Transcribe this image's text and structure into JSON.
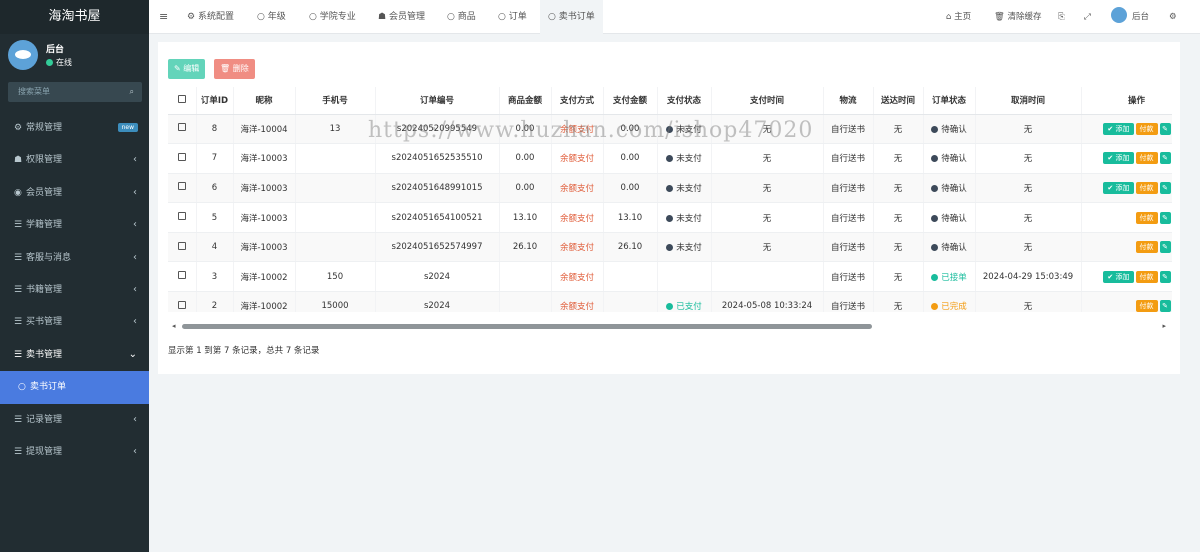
{
  "brand": "海淘书屋",
  "user": {
    "name": "后台",
    "status": "在线"
  },
  "search": {
    "placeholder": "搜索菜单"
  },
  "sidebar": {
    "items": [
      {
        "label": "常规管理",
        "badge": "new"
      },
      {
        "label": "权限管理"
      },
      {
        "label": "会员管理"
      },
      {
        "label": "学籍管理"
      },
      {
        "label": "客服与消息"
      },
      {
        "label": "书籍管理"
      },
      {
        "label": "买书管理"
      },
      {
        "label": "卖书管理"
      },
      {
        "label": "卖书订单"
      },
      {
        "label": "记录管理"
      },
      {
        "label": "提现管理"
      }
    ]
  },
  "tabs": [
    "系统配置",
    "年级",
    "学院专业",
    "会员管理",
    "商品",
    "订单",
    "卖书订单"
  ],
  "topright": {
    "home": "主页",
    "clear_cache": "清除缓存",
    "user": "后台"
  },
  "toolbar": {
    "edit": "编辑",
    "delete": "删除"
  },
  "table": {
    "columns": [
      "订单ID",
      "昵称",
      "手机号",
      "订单编号",
      "商品金额",
      "支付方式",
      "支付金额",
      "支付状态",
      "支付时间",
      "物流",
      "送达时间",
      "订单状态",
      "取消时间",
      "操作"
    ],
    "rows": [
      {
        "id": "8",
        "nick": "海洋-10004",
        "phone": "13",
        "order_no": "s20240520995549",
        "amount": "0.00",
        "pay_method": "余额支付",
        "pay_amount": "0.00",
        "pay_status": "未支付",
        "pay_time": "无",
        "logistics": "自行送书",
        "deliver_time": "无",
        "order_status": "待确认",
        "cancel_time": "无"
      },
      {
        "id": "7",
        "nick": "海洋-10003",
        "phone": "",
        "order_no": "s2024051652535510",
        "amount": "0.00",
        "pay_method": "余额支付",
        "pay_amount": "0.00",
        "pay_status": "未支付",
        "pay_time": "无",
        "logistics": "自行送书",
        "deliver_time": "无",
        "order_status": "待确认",
        "cancel_time": "无"
      },
      {
        "id": "6",
        "nick": "海洋-10003",
        "phone": "",
        "order_no": "s2024051648991015",
        "amount": "0.00",
        "pay_method": "余额支付",
        "pay_amount": "0.00",
        "pay_status": "未支付",
        "pay_time": "无",
        "logistics": "自行送书",
        "deliver_time": "无",
        "order_status": "待确认",
        "cancel_time": "无"
      },
      {
        "id": "5",
        "nick": "海洋-10003",
        "phone": "",
        "order_no": "s2024051654100521",
        "amount": "13.10",
        "pay_method": "余额支付",
        "pay_amount": "13.10",
        "pay_status": "未支付",
        "pay_time": "无",
        "logistics": "自行送书",
        "deliver_time": "无",
        "order_status": "待确认",
        "cancel_time": "无"
      },
      {
        "id": "4",
        "nick": "海洋-10003",
        "phone": "",
        "order_no": "s2024051652574997",
        "amount": "26.10",
        "pay_method": "余额支付",
        "pay_amount": "26.10",
        "pay_status": "未支付",
        "pay_time": "无",
        "logistics": "自行送书",
        "deliver_time": "无",
        "order_status": "待确认",
        "cancel_time": "无"
      },
      {
        "id": "3",
        "nick": "海洋-10002",
        "phone": "150",
        "order_no": "s2024",
        "amount": "",
        "pay_method": "余额支付",
        "pay_amount": "",
        "pay_status": "",
        "pay_time": "",
        "logistics": "自行送书",
        "deliver_time": "无",
        "order_status": "已接单",
        "cancel_time": "2024-04-29 15:03:49"
      },
      {
        "id": "2",
        "nick": "海洋-10002",
        "phone": "15000",
        "order_no": "s2024",
        "amount": "",
        "pay_method": "余额支付",
        "pay_amount": "",
        "pay_status": "已支付",
        "pay_time": "2024-05-08 10:33:24",
        "logistics": "自行送书",
        "deliver_time": "无",
        "order_status": "已完成",
        "cancel_time": "无"
      }
    ],
    "op_labels": {
      "add": "添加",
      "pay": "付款"
    },
    "row_ops": [
      [
        "add",
        "pay",
        "edit",
        "del"
      ],
      [
        "add",
        "pay",
        "edit",
        "del"
      ],
      [
        "add",
        "pay",
        "edit",
        "del"
      ],
      [
        "pay",
        "edit",
        "del"
      ],
      [
        "pay",
        "edit",
        "del"
      ],
      [
        "add",
        "pay",
        "edit",
        "del"
      ],
      [
        "pay",
        "edit",
        "del"
      ]
    ]
  },
  "footer": "显示第 1 到第 7 条记录，总共 7 条记录",
  "watermark": "https://www.huzhan.com/ishop47020",
  "colors": {
    "unpaid": "#3d4a5a",
    "paid": "#18bc9c",
    "pending": "#3d4a5a",
    "accepted": "#18bc9c",
    "done": "#f39c12",
    "pay_method": "#e05d3a"
  }
}
